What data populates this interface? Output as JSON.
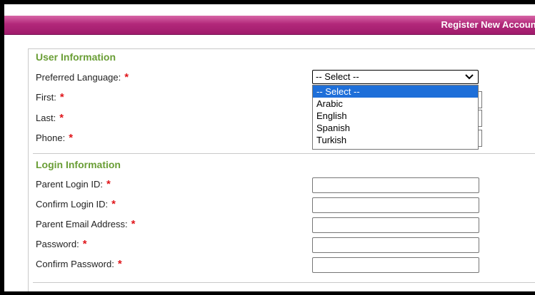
{
  "header": {
    "title": "Register New Account"
  },
  "user_info": {
    "section_title": "User Information",
    "fields": {
      "language_label": "Preferred Language:",
      "first_label": "First:",
      "last_label": "Last:",
      "phone_label": "Phone:"
    },
    "language_select": {
      "selected": "-- Select --",
      "options": [
        "-- Select --",
        "Arabic",
        "English",
        "Spanish",
        "Turkish"
      ],
      "highlighted_option": "-- Select --"
    }
  },
  "login_info": {
    "section_title": "Login Information",
    "fields": {
      "login_id_label": "Parent Login ID:",
      "confirm_login_label": "Confirm Login ID:",
      "email_label": "Parent Email Address:",
      "password_label": "Password:",
      "confirm_password_label": "Confirm Password:"
    }
  },
  "required_marker": "*",
  "colors": {
    "header_band": "#b2287a",
    "section_title": "#6a9e36",
    "required": "#e0161b",
    "option_highlight": "#1e6fd9"
  }
}
